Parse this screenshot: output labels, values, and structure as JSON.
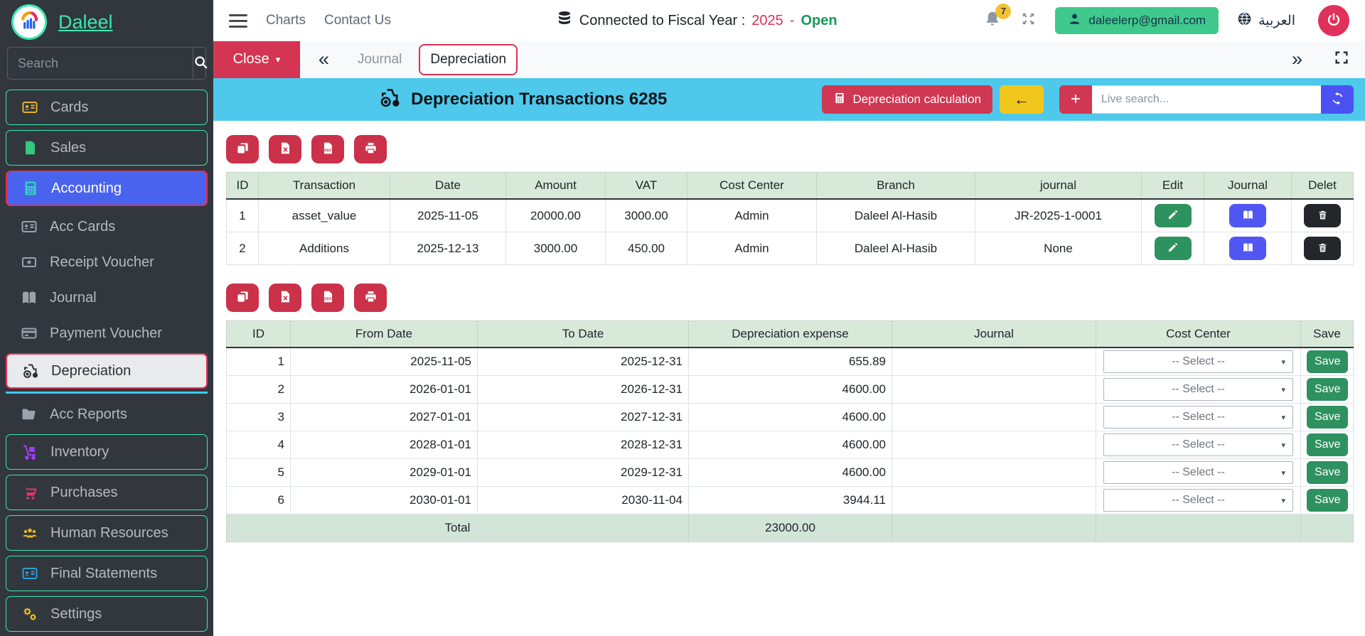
{
  "colors": {
    "sidebar_bg": "#31373d",
    "accent_teal": "#3be8b0",
    "accounting_blue": "#4a63ee",
    "danger_red": "#d43552",
    "cyan_header": "#4ec9ec",
    "yellow": "#f2c71d",
    "indigo": "#4b52f3",
    "green": "#2e9160",
    "table_header_green": "#d8e9da",
    "fiscal_year_red": "#e0315a",
    "fiscal_open_green": "#17995c",
    "badge_yellow": "#f1c232"
  },
  "icons": {
    "caret_down": "▾",
    "chevron_double_left": "«",
    "chevron_double_right": "»",
    "arrow_left": "←",
    "plus": "+"
  },
  "brand": {
    "name": "Daleel"
  },
  "sidebar": {
    "search_placeholder": "Search",
    "items": {
      "cards": "Cards",
      "sales": "Sales",
      "accounting": "Accounting",
      "acc_cards": "Acc Cards",
      "receipt_voucher": "Receipt Voucher",
      "journal": "Journal",
      "payment_voucher": "Payment Voucher",
      "depreciation": "Depreciation",
      "acc_reports": "Acc Reports",
      "inventory": "Inventory",
      "purchases": "Purchases",
      "human_resources": "Human Resources",
      "final_statements": "Final Statements",
      "settings": "Settings"
    }
  },
  "navbar": {
    "links": {
      "charts": "Charts",
      "contact": "Contact Us"
    },
    "fiscal": {
      "label": "Connected to Fiscal Year :",
      "year": "2025",
      "dash": "-",
      "status": "Open"
    },
    "notifications_count": "7",
    "account_email": "daleelerp@gmail.com",
    "language": "العربية"
  },
  "tabbar": {
    "close_label": "Close",
    "tabs": {
      "journal": "Journal",
      "depreciation": "Depreciation"
    }
  },
  "page_header": {
    "title": "Depreciation Transactions 6285",
    "calc_button": "Depreciation calculation",
    "live_search_placeholder": "Live search..."
  },
  "transactions_table": {
    "headers": [
      "ID",
      "Transaction",
      "Date",
      "Amount",
      "VAT",
      "Cost Center",
      "Branch",
      "journal",
      "Edit",
      "Journal",
      "Delet"
    ],
    "rows": [
      {
        "id": "1",
        "transaction": "asset_value",
        "date": "2025-11-05",
        "amount": "20000.00",
        "vat": "3000.00",
        "cost_center": "Admin",
        "branch": "Daleel Al-Hasib",
        "journal": "JR-2025-1-0001"
      },
      {
        "id": "2",
        "transaction": "Additions",
        "date": "2025-12-13",
        "amount": "3000.00",
        "vat": "450.00",
        "cost_center": "Admin",
        "branch": "Daleel Al-Hasib",
        "journal": "None"
      }
    ]
  },
  "schedule_table": {
    "headers": [
      "ID",
      "From Date",
      "To Date",
      "Depreciation expense",
      "Journal",
      "Cost Center",
      "Save"
    ],
    "select_placeholder": "-- Select --",
    "save_label": "Save",
    "rows": [
      {
        "id": "1",
        "from": "2025-11-05",
        "to": "2025-12-31",
        "expense": "655.89"
      },
      {
        "id": "2",
        "from": "2026-01-01",
        "to": "2026-12-31",
        "expense": "4600.00"
      },
      {
        "id": "3",
        "from": "2027-01-01",
        "to": "2027-12-31",
        "expense": "4600.00"
      },
      {
        "id": "4",
        "from": "2028-01-01",
        "to": "2028-12-31",
        "expense": "4600.00"
      },
      {
        "id": "5",
        "from": "2029-01-01",
        "to": "2029-12-31",
        "expense": "4600.00"
      },
      {
        "id": "6",
        "from": "2030-01-01",
        "to": "2030-11-04",
        "expense": "3944.11"
      }
    ],
    "total_label": "Total",
    "total_value": "23000.00"
  }
}
